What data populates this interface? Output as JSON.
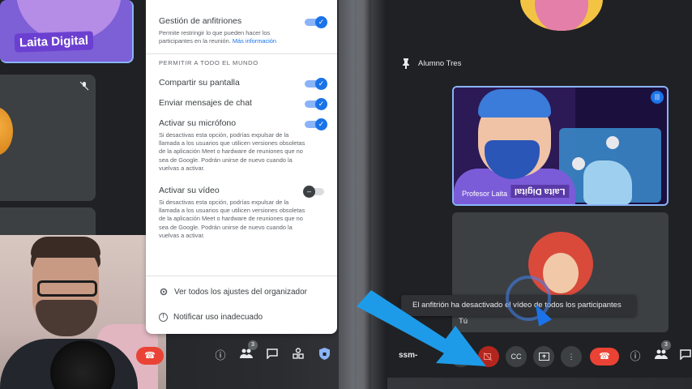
{
  "left_meet": {
    "brand_label": "Laita Digital",
    "mute_icon": "mic-off-icon"
  },
  "settings_panel": {
    "host_management": {
      "title": "Gestión de anfitriones",
      "description": "Permite restringir lo que pueden hacer los participantes en la reunión.",
      "link": "Más información",
      "enabled": true
    },
    "section_heading": "PERMITIR A TODO EL MUNDO",
    "items": [
      {
        "label": "Compartir su pantalla",
        "enabled": true
      },
      {
        "label": "Enviar mensajes de chat",
        "enabled": true
      },
      {
        "label": "Activar su micrófono",
        "enabled": true,
        "description": "Si desactivas esta opción, podrías expulsar de la llamada a los usuarios que utilicen versiones obsoletas de la aplicación Meet o hardware de reuniones que no sea de Google. Podrán unirse de nuevo cuando la vuelvas a activar."
      },
      {
        "label": "Activar su vídeo",
        "enabled": false,
        "description": "Si desactivas esta opción, podrías expulsar de la llamada a los usuarios que utilicen versiones obsoletas de la aplicación Meet o hardware de reuniones que no sea de Google. Podrán unirse de nuevo cuando la vuelvas a activar."
      }
    ],
    "all_settings_link": "Ver todos los ajustes del organizador",
    "report_link": "Notificar uso inadecuado"
  },
  "left_toolbar": {
    "participants_count": "3"
  },
  "right_meet": {
    "pinned_name": "Alumno Tres",
    "video_caption": "Profesor Laita",
    "video_brand": "Laita Digital",
    "self_name": "Tú",
    "toast": "El anfitrión ha desactivado el vídeo de todos los participantes",
    "meeting_code": "ssm-",
    "participants_count": "3"
  },
  "colors": {
    "accent_blue": "#1a73e8",
    "hangup_red": "#ea4335",
    "meet_dark": "#202124"
  }
}
